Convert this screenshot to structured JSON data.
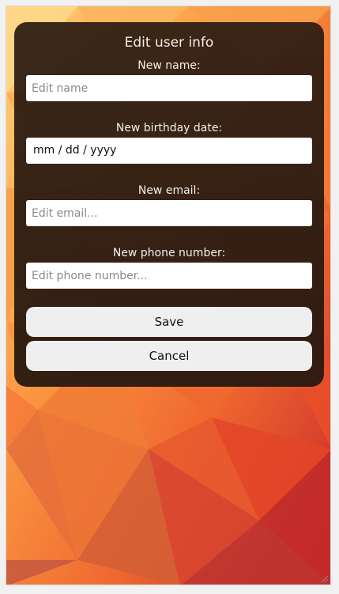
{
  "form": {
    "title": "Edit user info",
    "name_label": "New name:",
    "name_placeholder": "Edit name",
    "birthday_label": "New birthday date:",
    "birthday_format": "mm / dd / yyyy",
    "email_label": "New email:",
    "email_placeholder": "Edit email...",
    "phone_label": "New phone number:",
    "phone_placeholder": "Edit phone number..."
  },
  "buttons": {
    "save_label": "Save",
    "cancel_label": "Cancel"
  },
  "colors": {
    "card_bg": "#2c1c12",
    "button_bg": "#efefef",
    "label_text": "#f4efea"
  }
}
